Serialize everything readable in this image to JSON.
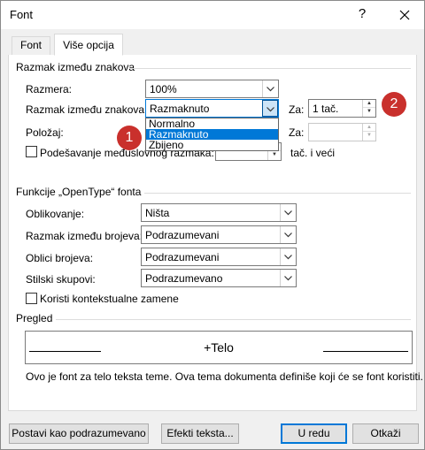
{
  "window": {
    "title": "Font",
    "help_label": "?",
    "close_label": "✕"
  },
  "tabs": [
    {
      "label": "Font"
    },
    {
      "label": "Više opcija"
    }
  ],
  "spacing_section": {
    "title": "Razmak između znakova",
    "scale_label": "Razmera:",
    "scale_value": "100%",
    "spacing_label": "Razmak između znakova:",
    "spacing_value": "Razmaknuto",
    "by_label": "Za:",
    "by_value": "1 tač.",
    "position_label": "Položaj:",
    "position_by_label": "Za:",
    "kerning_label": "Podešavanje međuslovnog razmaka:",
    "kerning_suffix": "tač. i veći",
    "dropdown_options": [
      "Normalno",
      "Razmaknuto",
      "Zbijeno"
    ],
    "dropdown_selected_index": 1
  },
  "opentype_section": {
    "title": "Funkcije „OpenType“ fonta",
    "ligatures_label": "Oblikovanje:",
    "ligatures_value": "Ništa",
    "number_spacing_label": "Razmak između brojeva:",
    "number_spacing_value": "Podrazumevani",
    "number_forms_label": "Oblici brojeva:",
    "number_forms_value": "Podrazumevani",
    "stylistic_sets_label": "Stilski skupovi:",
    "stylistic_sets_value": "Podrazumevano",
    "contextual_label": "Koristi kontekstualne zamene"
  },
  "preview_section": {
    "title": "Pregled",
    "sample": "+Telo",
    "description": "Ovo je font za telo teksta teme. Ova tema dokumenta definiše koji će se font koristiti."
  },
  "buttons": {
    "set_default": "Postavi kao podrazumevano",
    "text_effects": "Efekti teksta...",
    "ok": "U redu",
    "cancel": "Otkaži"
  },
  "callouts": {
    "badge1": "1",
    "badge2": "2",
    "color": "#c9302c"
  },
  "colors": {
    "selection": "#0078d7",
    "default_button_border": "#0078d7"
  }
}
